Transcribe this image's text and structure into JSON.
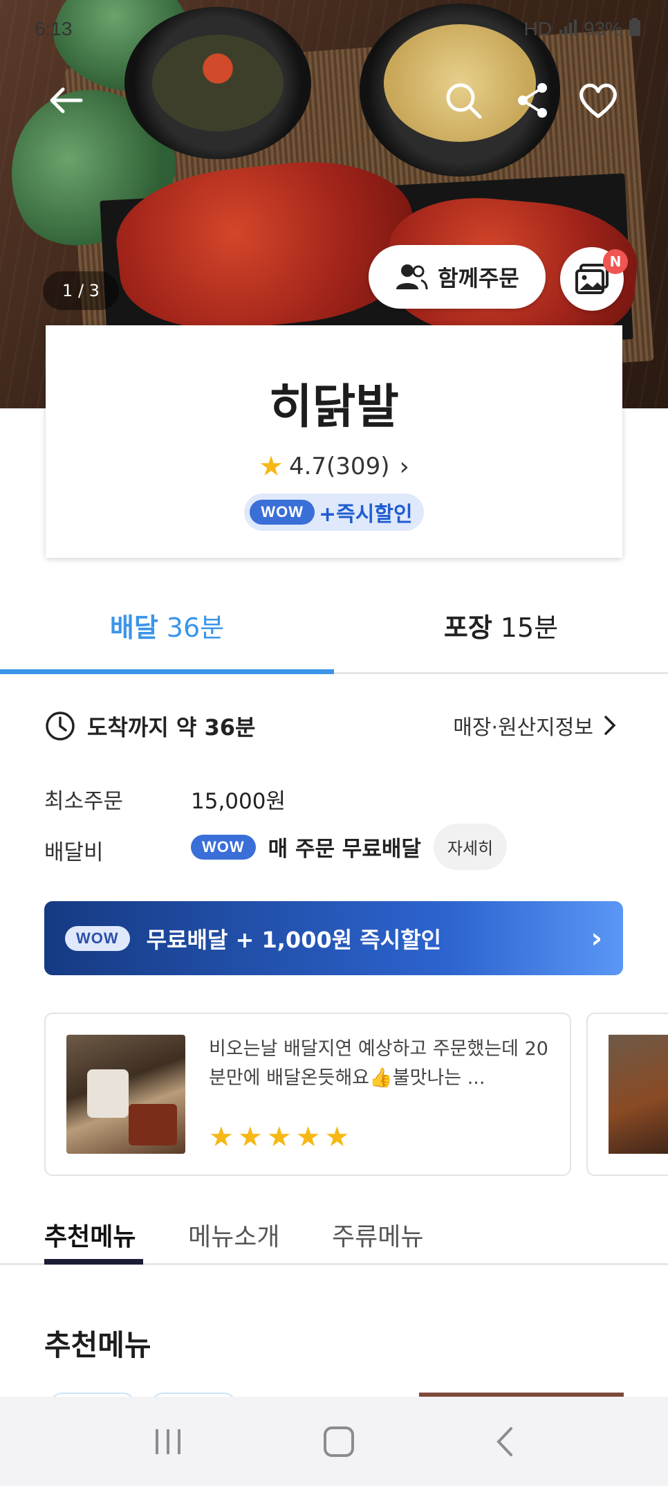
{
  "status_bar": {
    "time": "6:13",
    "battery": "93%",
    "network": "HD"
  },
  "hero": {
    "image_counter": "1 / 3",
    "together_order_label": "함께주문",
    "photo_badge": "N"
  },
  "store": {
    "name": "히닭발",
    "rating": "4.7(309)",
    "wow_tag": "WOW",
    "wow_promo": "+즉시할인"
  },
  "delivery_tabs": [
    {
      "type": "배달",
      "time": "36분",
      "active": true
    },
    {
      "type": "포장",
      "time": "15분",
      "active": false
    }
  ],
  "eta": {
    "label": "도착까지 약 36분",
    "store_info_link": "매장·원산지정보"
  },
  "min_order": {
    "label": "최소주문",
    "value": "15,000원"
  },
  "delivery_fee": {
    "label": "배달비",
    "wow_tag": "WOW",
    "value": "매 주문 무료배달",
    "detail_button": "자세히"
  },
  "wow_banner": {
    "tag": "WOW",
    "text": "무료배달 + 1,000원 즉시할인"
  },
  "review": {
    "text": "비오는날 배달지연 예상하고 주문했는데 20분만에 배달온듯해요👍불맛나는 ...",
    "stars": 5
  },
  "menu_tabs": [
    {
      "label": "추천메뉴",
      "active": true
    },
    {
      "label": "메뉴소개",
      "active": false
    },
    {
      "label": "주류메뉴",
      "active": false
    }
  ],
  "section_title": "추천메뉴",
  "colors": {
    "accent_blue": "#3b95e8",
    "wow_blue": "#3a6fd8",
    "star": "#f6b816",
    "badge_red": "#f05552"
  }
}
